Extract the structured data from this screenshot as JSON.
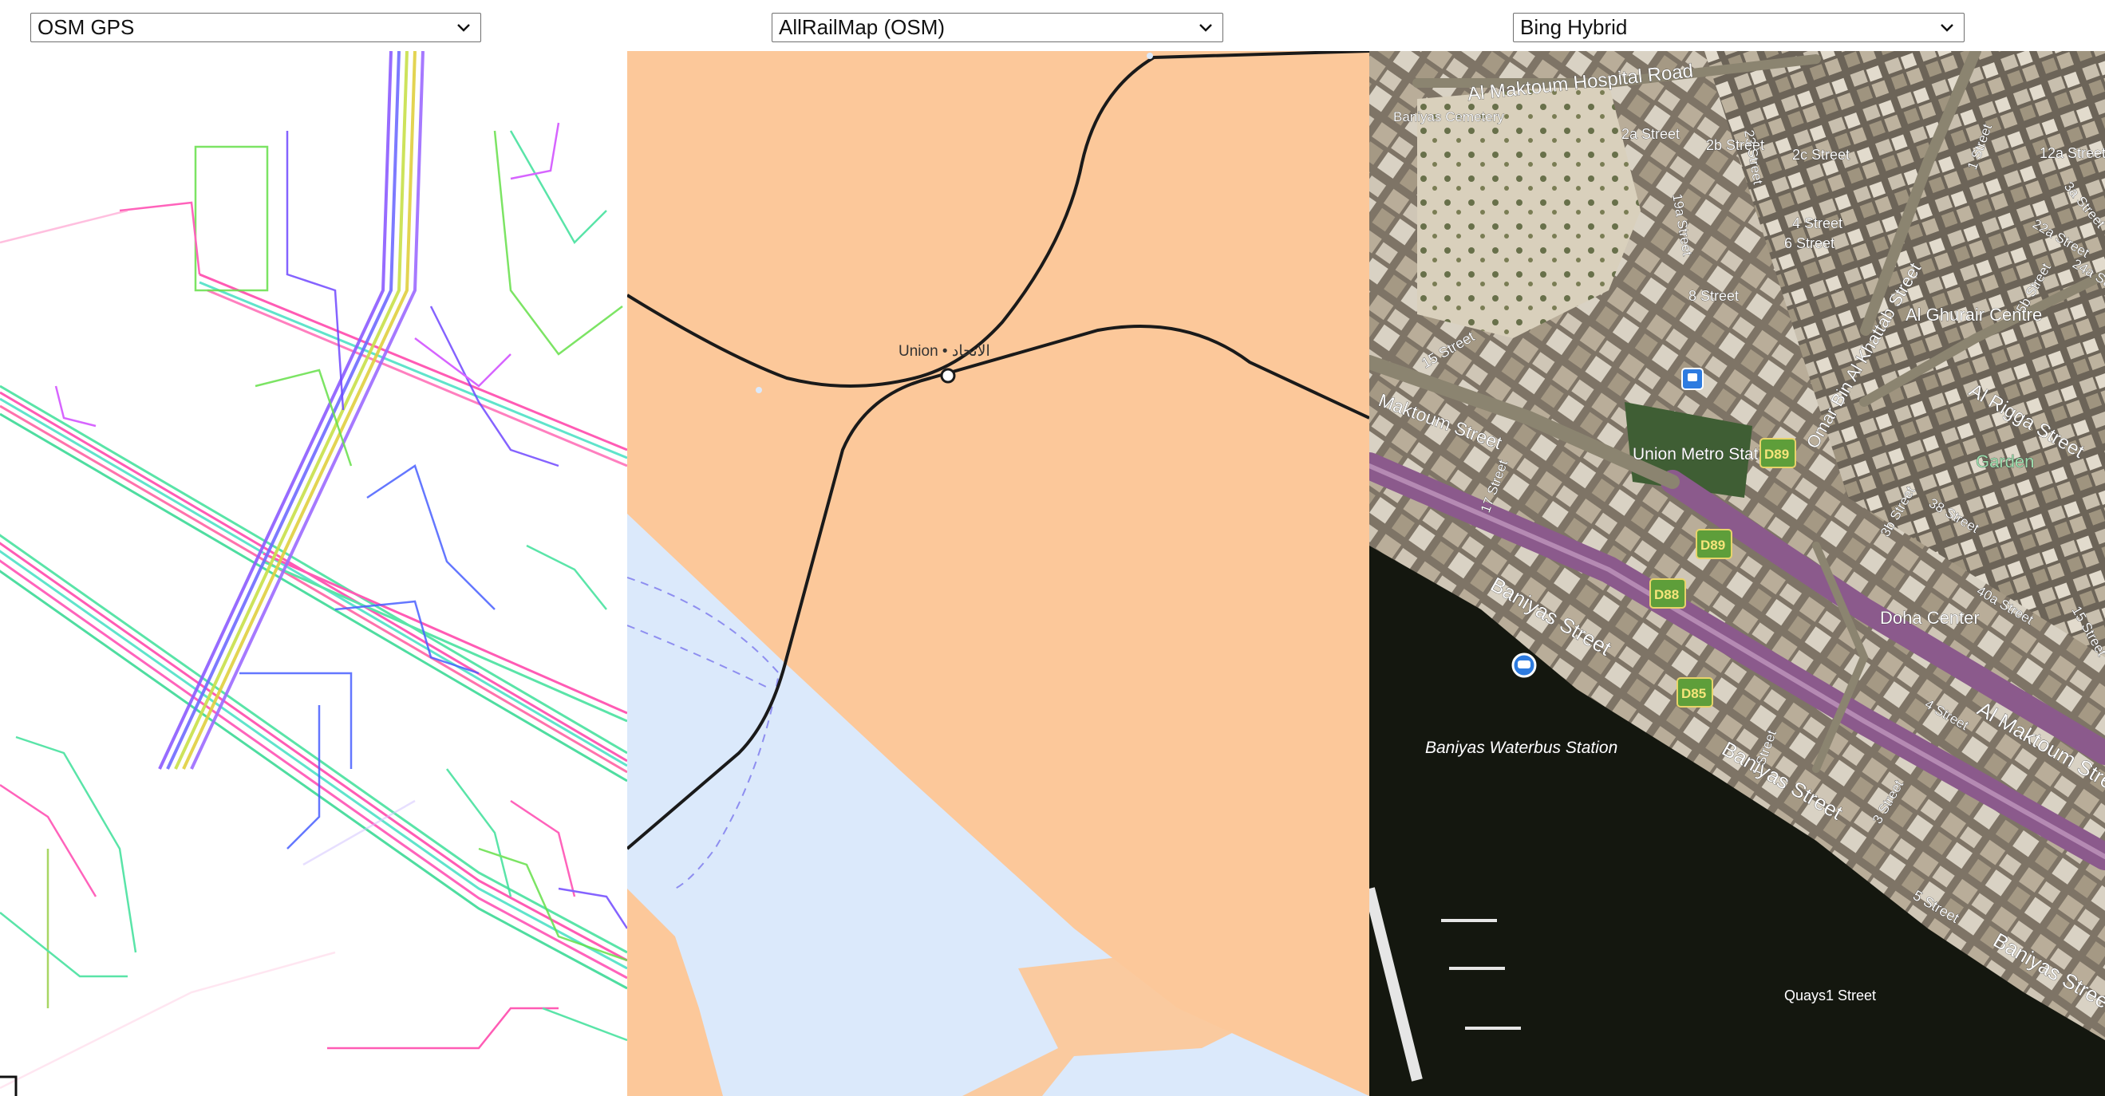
{
  "selectors": {
    "left": {
      "selected": "OSM GPS"
    },
    "middle": {
      "selected": "AllRailMap (OSM)"
    },
    "right": {
      "selected": "Bing Hybrid"
    }
  },
  "rail_map": {
    "station_label": "Union • الاتحاد",
    "colors": {
      "land": "#fcc89a",
      "water": "#dbe9fb",
      "rail": "#1a1a1a"
    }
  },
  "bing_map": {
    "labels": {
      "hospital_road": "Al Maktoum Hospital Road",
      "cemetery": "Baniyas Cemetery",
      "street_2a": "2a Street",
      "street_2b": "2b Street",
      "street_2c": "2c Street",
      "street_23": "23 Street",
      "street_19a": "19a Street",
      "street_4": "4 Street",
      "street_6": "6 Street",
      "street_8": "8 Street",
      "street_15": "15 Street",
      "street_17": "17 Street",
      "street_12a": "12a Street",
      "street_1": "1 Street",
      "street_3a": "3a Street",
      "street_22a": "22a Street",
      "street_24a": "24a Street",
      "street_5b": "5b Street",
      "street_3b": "3b Street",
      "street_38": "38 Street",
      "street_40a": "40a Street",
      "street_15b": "15 Street",
      "street_4b": "4 Street",
      "street_3c": "3 Street",
      "street_5": "5 Street",
      "street_1b": "1 Street",
      "ghurair": "Al Ghurair Centre",
      "rigga": "Al Rigga Street",
      "khattab": "Omar Bin Al Khattab Street",
      "maktoum_street": "Maktoum Street",
      "union_metro": "Union Metro Station",
      "garden": "Garden",
      "doha": "Doha Center",
      "baniyas_street": "Baniyas Street",
      "baniyas_street_2": "Baniyas Street",
      "baniyas_street_3": "Baniyas Street",
      "al_maktoum_street": "Al Maktoum Street",
      "waterbus": "Baniyas Waterbus Station",
      "quays": "Quays1 Street",
      "d89_a": "D89",
      "d89_b": "D89",
      "d88": "D88",
      "d85": "D85"
    }
  }
}
